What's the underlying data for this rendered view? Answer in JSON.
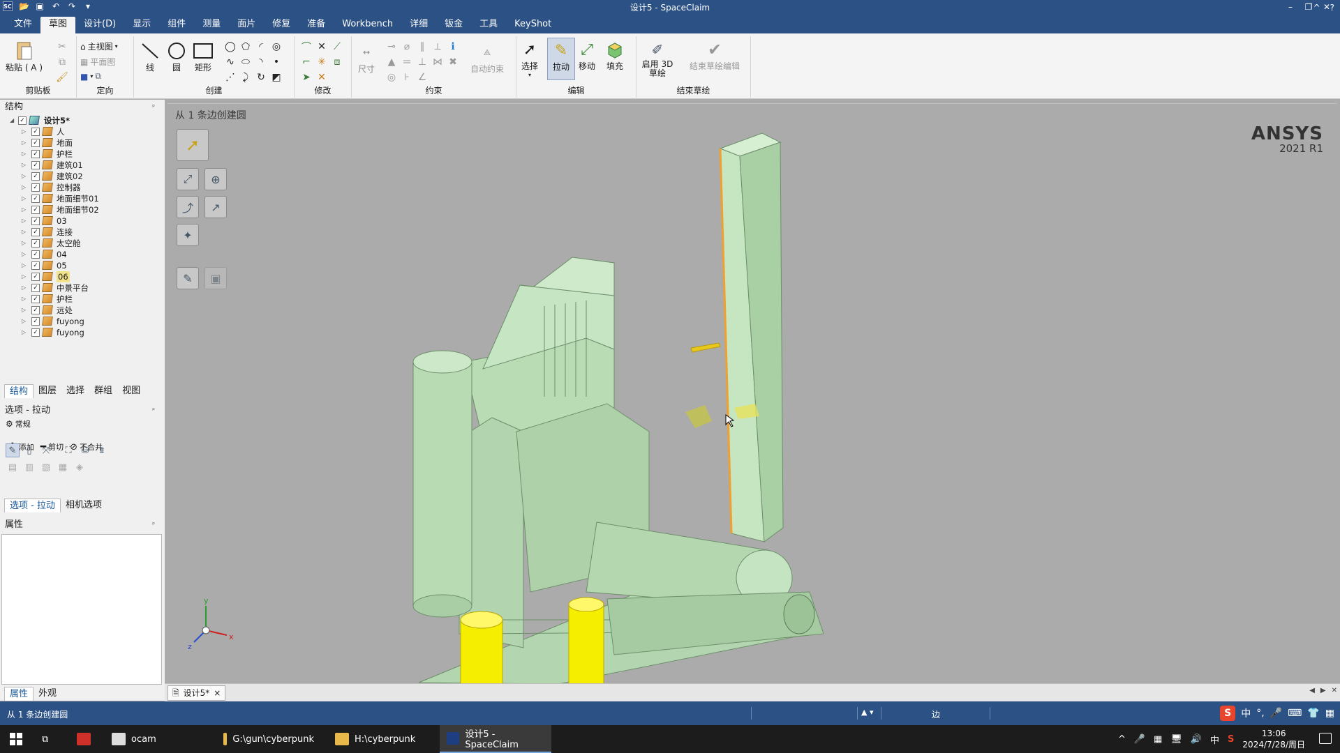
{
  "title_bar": {
    "window_title": "设计5 - SpaceClaim",
    "logo_text": "SC",
    "minimize": "–",
    "restore": "❐",
    "close": "✕"
  },
  "menu": {
    "items": [
      "文件",
      "草图",
      "设计(D)",
      "显示",
      "组件",
      "测量",
      "面片",
      "修复",
      "准备",
      "Workbench",
      "详细",
      "钣金",
      "工具",
      "KeyShot"
    ],
    "active_index": 1,
    "collapse": "^",
    "help": "?"
  },
  "ribbon": {
    "clipboard": {
      "paste_label": "粘贴 ( A )",
      "group_label": "剪贴板"
    },
    "orient": {
      "home_view": "主视图",
      "plan_view": "平面图",
      "group_label": "定向"
    },
    "create": {
      "line": "线",
      "circle": "圆",
      "rectangle": "矩形",
      "group_label": "创建"
    },
    "modify": {
      "group_label": "修改"
    },
    "constraints": {
      "dimension": "尺寸",
      "auto_constraint": "自动约束",
      "group_label": "约束"
    },
    "edit": {
      "select": "选择",
      "pull": "拉动",
      "move": "移动",
      "fill": "填充",
      "group_label": "编辑"
    },
    "end_sketch": {
      "enable_3d": "启用 3D 草绘",
      "end_edit": "结束草绘编辑",
      "group_label": "结束草绘"
    }
  },
  "structure_panel": {
    "title": "结构",
    "pin": "ᵖ",
    "root": "设计5*",
    "items": [
      "人",
      "地面",
      "护栏",
      "建筑01",
      "建筑02",
      "控制器",
      "地面细节01",
      "地面细节02",
      "03",
      "连接",
      "太空舱",
      "04",
      "05",
      "06",
      "中景平台",
      "护栏",
      "远处",
      "fuyong",
      "fuyong"
    ],
    "highlighted_index": 13,
    "tabs": [
      "结构",
      "图层",
      "选择",
      "群组",
      "视图"
    ],
    "active_tab": 0
  },
  "options_panel": {
    "title": "选项 - 拉动",
    "general": "常规",
    "add": "添加",
    "cut": "剪切",
    "no_merge": "不合并",
    "tabs": [
      "选项 - 拉动",
      "相机选项"
    ]
  },
  "properties_panel": {
    "title": "属性",
    "tabs": [
      "属性",
      "外观"
    ]
  },
  "viewport": {
    "hint": "从 1 条边创建圆",
    "brand": "ANSYS",
    "version": "2021 R1",
    "axis_x": "x",
    "axis_y": "y",
    "axis_z": "z"
  },
  "doc_tab": {
    "label": "设计5*",
    "close": "×"
  },
  "status_bar": {
    "text": "从 1 条边创建圆",
    "mode": "边"
  },
  "taskbar": {
    "items": [
      "ocam",
      "G:\\gun\\cyberpunk",
      "H:\\cyberpunk",
      "设计5 - SpaceClaim"
    ],
    "active_index": 3,
    "ime_lang": "中",
    "time": "13:06",
    "date": "2024/7/28/周日"
  },
  "colors": {
    "titlebar": "#2c5185",
    "ribbon": "#f4f4f4",
    "viewport_bg": "#ababab",
    "model_green": "#b5dcb3",
    "highlight_yellow": "#f5ee00",
    "selected_edge": "#f0a030"
  }
}
